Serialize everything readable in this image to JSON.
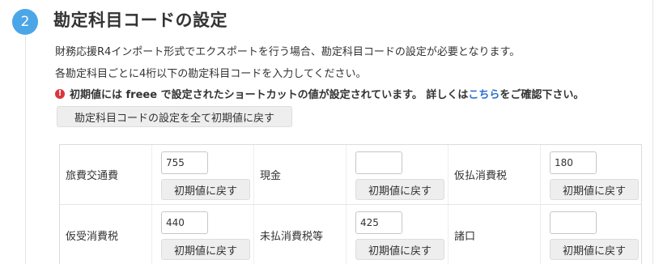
{
  "section": {
    "step_number": "2",
    "title": "勘定科目コードの設定"
  },
  "description": {
    "line1": "財務応援R4インポート形式でエクスポートを行う場合、勘定科目コードの設定が必要となります。",
    "line2": "各勘定科目ごとに4桁以下の勘定科目コードを入力してください。"
  },
  "warning": {
    "icon": "exclamation-circle-icon",
    "icon_glyph": "!",
    "icon_color": "#d9363e",
    "text_before": "初期値には freee で設定されたショートカットの値が設定されています。 詳しくは",
    "link_text": "こちら",
    "text_after": "をご確認下さい。",
    "link_color": "#2a6fcf"
  },
  "reset_all_label": "勘定科目コードの設定を全て初期値に戻す",
  "reset_label": "初期値に戻す",
  "accent_color": "#4ba6e8",
  "rows": [
    {
      "cells": [
        {
          "label": "旅費交通費",
          "value": "755"
        },
        {
          "label": "現金",
          "value": ""
        },
        {
          "label": "仮払消費税",
          "value": "180"
        }
      ]
    },
    {
      "cells": [
        {
          "label": "仮受消費税",
          "value": "440"
        },
        {
          "label": "未払消費税等",
          "value": "425"
        },
        {
          "label": "諸口",
          "value": ""
        }
      ]
    }
  ]
}
